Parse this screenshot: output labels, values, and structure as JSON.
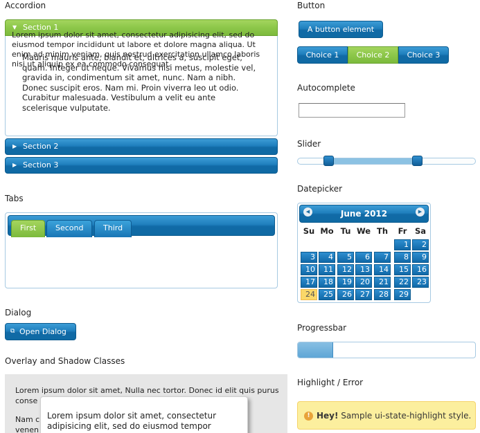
{
  "accordion": {
    "heading": "Accordion",
    "sections": [
      {
        "label": "Section 1",
        "open": true
      },
      {
        "label": "Section 2",
        "open": false
      },
      {
        "label": "Section 3",
        "open": false
      }
    ],
    "content": "Mauris mauris ante, blandit et, ultrices a, suscipit eget, quam. Integer ut neque. Vivamus nisi metus, molestie vel, gravida in, condimentum sit amet, nunc. Nam a nibh. Donec suscipit eros. Nam mi. Proin viverra leo ut odio. Curabitur malesuada. Vestibulum a velit eu ante scelerisque vulputate."
  },
  "tabs": {
    "heading": "Tabs",
    "items": [
      {
        "label": "First",
        "active": true
      },
      {
        "label": "Second",
        "active": false
      },
      {
        "label": "Third",
        "active": false
      }
    ],
    "content": "Lorem ipsum dolor sit amet, consectetur adipisicing elit, sed do eiusmod tempor incididunt ut labore et dolore magna aliqua. Ut enim ad minim veniam, quis nostrud exercitation ullamco laboris nisi ut aliquip ex ea commodo consequat."
  },
  "dialog": {
    "heading": "Dialog",
    "button_label": "Open Dialog",
    "button_icon": "new-window-icon"
  },
  "overlay": {
    "heading": "Overlay and Shadow Classes",
    "bg_line1": "Lorem ipsum dolor sit amet, Nulla nec tortor. Donec id elit quis purus",
    "bg_line2": "conse",
    "bg_line3": "Nam c",
    "bg_line4": "venen",
    "shadow_text": "Lorem ipsum dolor sit amet, consectetur adipisicing elit, sed do eiusmod tempor"
  },
  "button": {
    "heading": "Button",
    "element_label": "A button element",
    "choices": [
      "Choice 1",
      "Choice 2",
      "Choice 3"
    ],
    "active_choice": 1
  },
  "autocomplete": {
    "heading": "Autocomplete",
    "value": ""
  },
  "slider": {
    "heading": "Slider",
    "range_start_fraction": 0.175,
    "range_end_fraction": 0.67
  },
  "datepicker": {
    "heading": "Datepicker",
    "month_label": "June 2012",
    "prev_icon": "circle-triangle-w-icon",
    "next_icon": "circle-triangle-e-icon",
    "weekdays": [
      "Su",
      "Mo",
      "Tu",
      "We",
      "Th",
      "Fr",
      "Sa"
    ],
    "first_weekday_index": 5,
    "days_in_month": 30,
    "shown_days": 29,
    "today": 24
  },
  "progressbar": {
    "heading": "Progressbar",
    "value_percent": 20
  },
  "highlight": {
    "heading": "Highlight / Error",
    "strong": "Hey!",
    "text": " Sample ui-state-highlight style.",
    "icon": "info-icon"
  },
  "colors": {
    "accent_blue": "#1f7fbd",
    "accent_green": "#8dc74a",
    "highlight_bg": "#fcef9e",
    "today_bg": "#fad869"
  }
}
